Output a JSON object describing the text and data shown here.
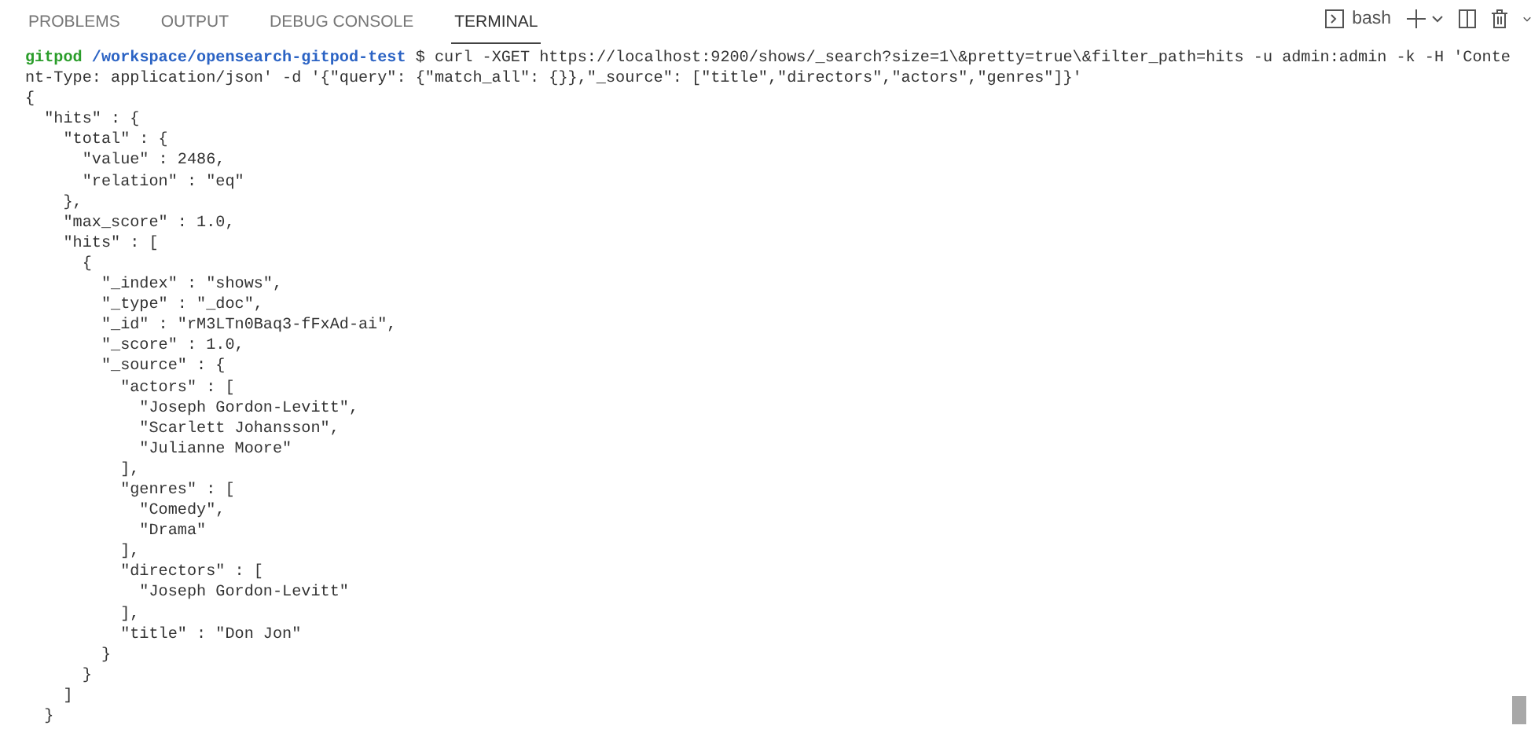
{
  "tabs": [
    {
      "label": "PROBLEMS",
      "selected": false
    },
    {
      "label": "OUTPUT",
      "selected": false
    },
    {
      "label": "DEBUG CONSOLE",
      "selected": false
    },
    {
      "label": "TERMINAL",
      "selected": true
    }
  ],
  "terminal_selector": {
    "label": "bash"
  },
  "terminal": {
    "prompt": {
      "user": "gitpod",
      "path": "/workspace/opensearch-gitpod-test",
      "command_lines": [
        "$ curl -XGET https://localhost:9200/shows/_search?size=1\\&pretty=true\\&filter_path=hits -u admin:admin -k -H 'Conte",
        "nt-Type: application/json' -d '{\"query\": {\"match_all\": {}},\"_source\": [\"title\",\"directors\",\"actors\",\"genres\"]}'"
      ]
    },
    "output_lines": [
      "{",
      "  \"hits\" : {",
      "    \"total\" : {",
      "      \"value\" : 2486,",
      "      \"relation\" : \"eq\"",
      "    },",
      "    \"max_score\" : 1.0,",
      "    \"hits\" : [",
      "      {",
      "        \"_index\" : \"shows\",",
      "        \"_type\" : \"_doc\",",
      "        \"_id\" : \"rM3LTn0Baq3-fFxAd-ai\",",
      "        \"_score\" : 1.0,",
      "        \"_source\" : {",
      "          \"actors\" : [",
      "            \"Joseph Gordon-Levitt\",",
      "            \"Scarlett Johansson\",",
      "            \"Julianne Moore\"",
      "          ],",
      "          \"genres\" : [",
      "            \"Comedy\",",
      "            \"Drama\"",
      "          ],",
      "          \"directors\" : [",
      "            \"Joseph Gordon-Levitt\"",
      "          ],",
      "          \"title\" : \"Don Jon\"",
      "        }",
      "      }",
      "    ]",
      "  }"
    ]
  }
}
